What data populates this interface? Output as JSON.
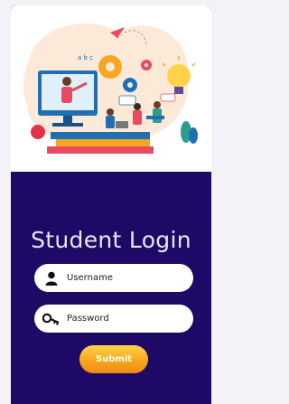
{
  "login": {
    "title": "Student Login",
    "username_placeholder": "Username",
    "password_placeholder": "Password",
    "submit_label": "Submit"
  },
  "icons": {
    "user": "user-icon",
    "key": "key-icon"
  },
  "colors": {
    "card_background": "#1e0a66",
    "button_gradient_top": "#ffd24a",
    "button_gradient_bottom": "#f08a16",
    "title_text": "#e9e6f5"
  }
}
